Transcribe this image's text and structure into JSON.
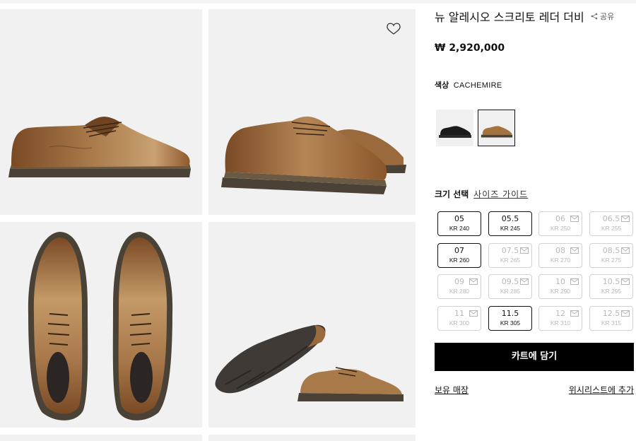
{
  "product": {
    "title": "뉴 알레시오 스크리토 레더 더비",
    "price": "₩ 2,920,000",
    "share_label": "공유"
  },
  "color": {
    "label": "색상",
    "value": "CACHEMIRE",
    "swatches": [
      {
        "name": "black",
        "selected": false
      },
      {
        "name": "cachemire",
        "selected": true
      }
    ]
  },
  "size": {
    "label": "크기 선택",
    "guide_link": "사이즈 가이드",
    "options": [
      {
        "eu": "05",
        "kr": "KR 240",
        "available": true
      },
      {
        "eu": "05.5",
        "kr": "KR 245",
        "available": true
      },
      {
        "eu": "06",
        "kr": "KR 250",
        "available": false
      },
      {
        "eu": "06.5",
        "kr": "KR 255",
        "available": false
      },
      {
        "eu": "07",
        "kr": "KR 260",
        "available": true
      },
      {
        "eu": "07.5",
        "kr": "KR 265",
        "available": false
      },
      {
        "eu": "08",
        "kr": "KR 270",
        "available": false
      },
      {
        "eu": "08.5",
        "kr": "KR 275",
        "available": false
      },
      {
        "eu": "09",
        "kr": "KR 280",
        "available": false
      },
      {
        "eu": "09.5",
        "kr": "KR 285",
        "available": false
      },
      {
        "eu": "10",
        "kr": "KR 290",
        "available": false
      },
      {
        "eu": "10.5",
        "kr": "KR 295",
        "available": false
      },
      {
        "eu": "11",
        "kr": "KR 300",
        "available": false
      },
      {
        "eu": "11.5",
        "kr": "KR 305",
        "available": true
      },
      {
        "eu": "12",
        "kr": "KR 310",
        "available": false
      },
      {
        "eu": "12.5",
        "kr": "KR 315",
        "available": false
      }
    ]
  },
  "actions": {
    "add_to_cart": "카트에 담기",
    "store_stock": "보유 매장",
    "add_wishlist": "위시리스트에 추가"
  },
  "icons": {
    "wishlist": "heart-icon",
    "share": "share-icon",
    "notify": "mail-icon"
  },
  "colors": {
    "leather": "#9b6a3c",
    "sole": "#4a4237",
    "accent": "#000000"
  }
}
